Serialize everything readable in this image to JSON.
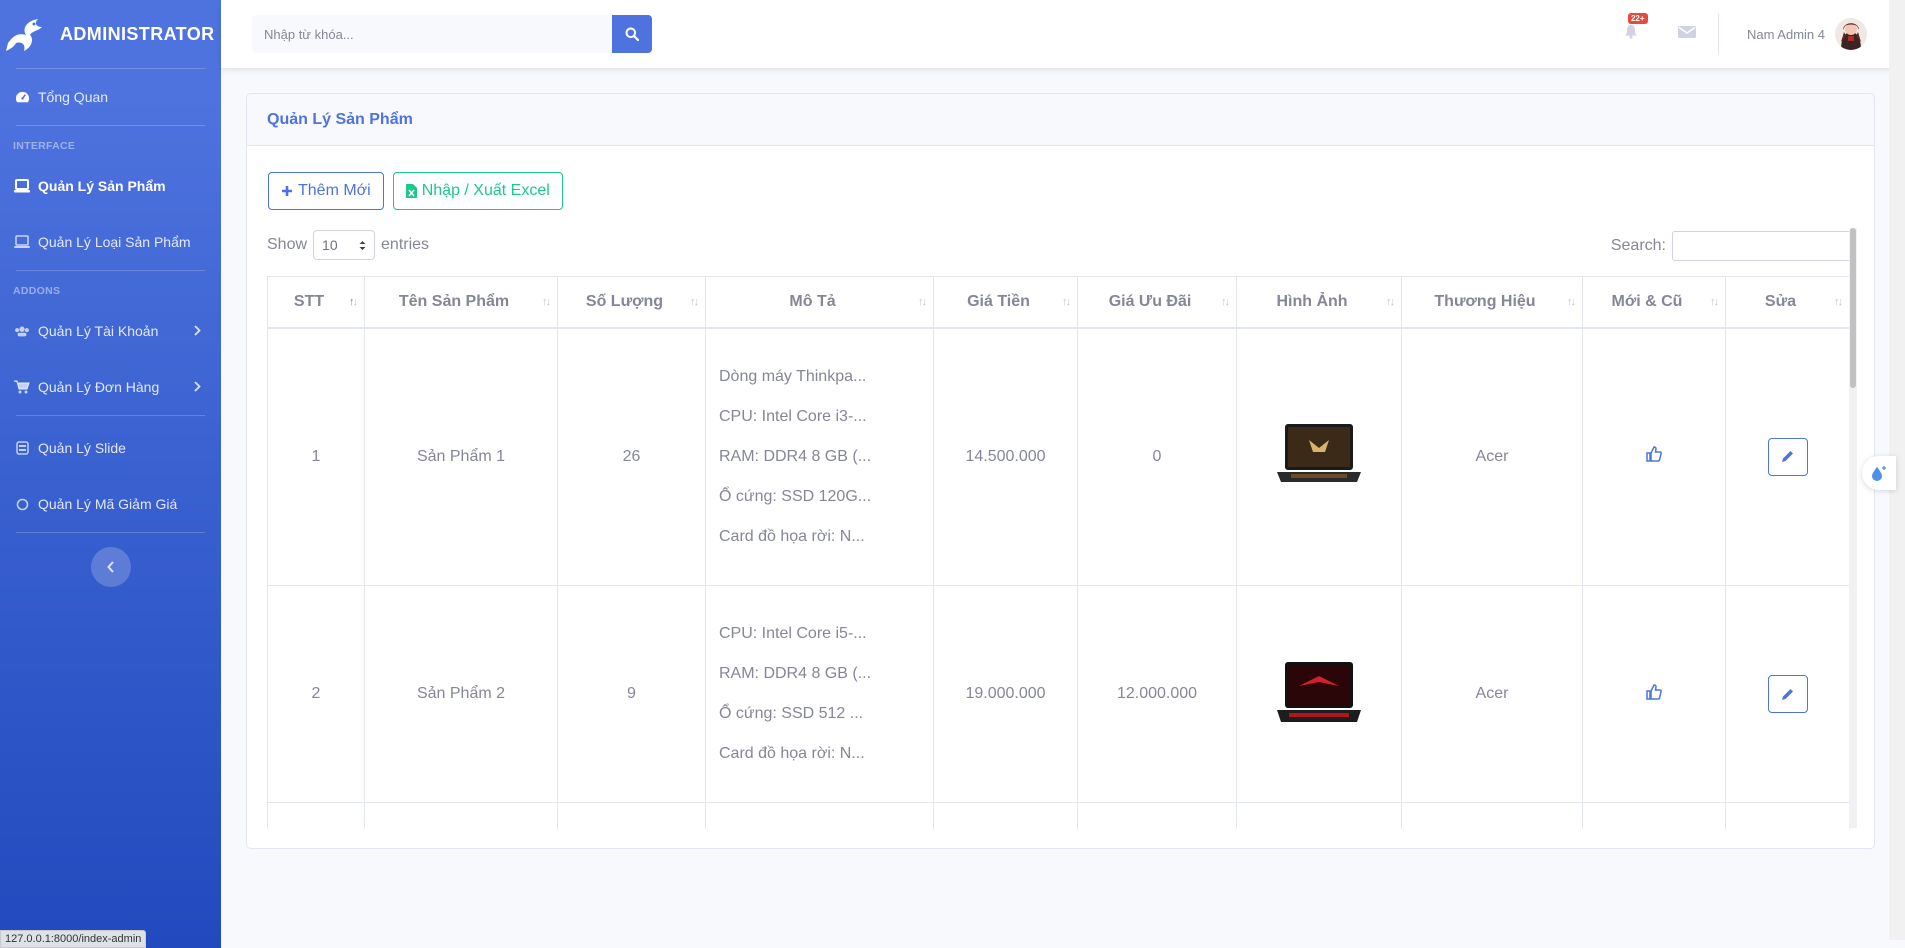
{
  "brand": {
    "title": "ADMINISTRATOR",
    "icon": "dragon-logo-icon"
  },
  "sidebar": {
    "dashboard": {
      "label": "Tổng Quan",
      "icon": "tachometer-icon"
    },
    "heading_interface": "INTERFACE",
    "products": {
      "label": "Quản Lý Sản Phẩm",
      "icon": "laptop-icon"
    },
    "categories": {
      "label": "Quản Lý Loại Sản Phẩm",
      "icon": "laptop-icon"
    },
    "heading_addons": "ADDONS",
    "accounts": {
      "label": "Quản Lý Tài Khoản",
      "icon": "users-icon"
    },
    "orders": {
      "label": "Quản Lý Đơn Hàng",
      "icon": "cart-icon"
    },
    "slides": {
      "label": "Quản Lý Slide",
      "icon": "image-icon"
    },
    "coupons": {
      "label": "Quản Lý Mã Giảm Giá",
      "icon": "tag-icon"
    }
  },
  "topbar": {
    "search_placeholder": "Nhập từ khóa...",
    "alerts_badge": "22+",
    "user_name": "Nam Admin 4"
  },
  "card": {
    "title": "Quản Lý Sản Phẩm",
    "add_button": "Thêm Mới",
    "excel_button": "Nhập / Xuất Excel"
  },
  "datatable": {
    "show_label": "Show",
    "entries_value": "10",
    "entries_label": "entries",
    "search_label": "Search:"
  },
  "table": {
    "headers": [
      "STT",
      "Tên Sản Phẩm",
      "Số Lượng",
      "Mô Tả",
      "Giá Tiền",
      "Giá Ưu Đãi",
      "Hình Ảnh",
      "Thương Hiệu",
      "Mới & Cũ",
      "Sửa"
    ],
    "rows": [
      {
        "stt": "1",
        "name": "Sản Phẩm 1",
        "qty": "26",
        "desc": [
          "Dòng máy Thinkpa...",
          "CPU: Intel Core i3-...",
          "RAM: DDR4 8 GB (...",
          "Ổ cứng: SSD 120G...",
          "Card đồ họa rời: N..."
        ],
        "price": "14.500.000",
        "sale": "0",
        "brand": "Acer"
      },
      {
        "stt": "2",
        "name": "Sản Phẩm 2",
        "qty": "9",
        "desc": [
          "CPU: Intel Core i5-...",
          "RAM: DDR4 8 GB (...",
          "Ổ cứng: SSD 512 ...",
          "Card đồ họa rời: N..."
        ],
        "price": "19.000.000",
        "sale": "12.000.000",
        "brand": "Acer"
      }
    ]
  },
  "status_bar": {
    "url": "127.0.0.1:8000/index-admin"
  },
  "colors": {
    "primary": "#4e73df",
    "success": "#1cc88a",
    "danger": "#e74a3b"
  }
}
